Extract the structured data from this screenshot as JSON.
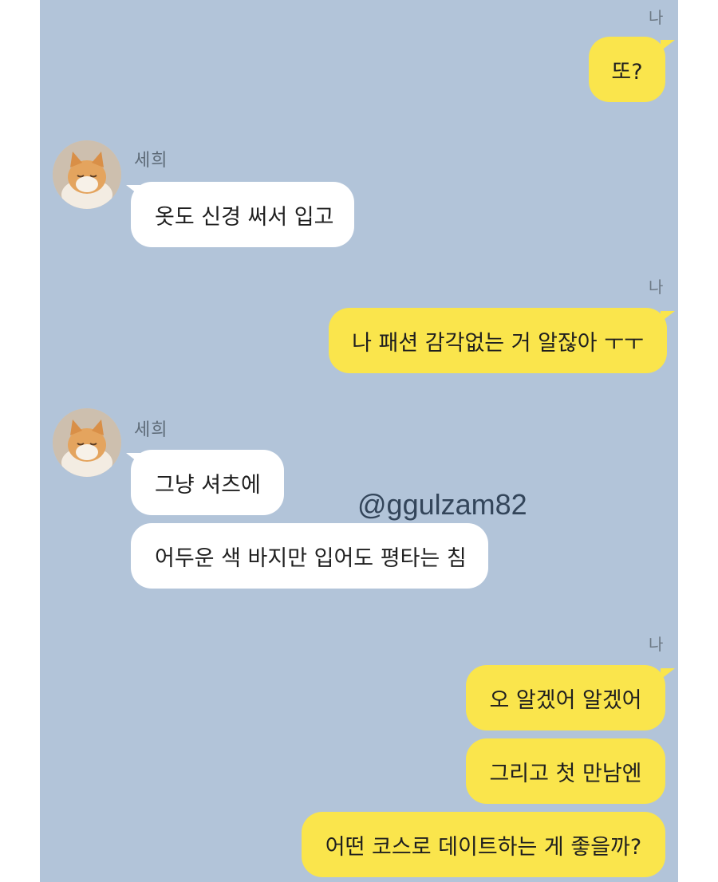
{
  "watermark": "@ggulzam82",
  "messages": {
    "me_name": "나",
    "other_name": "세희",
    "m1": "또?",
    "m2": "옷도 신경 써서 입고",
    "m3": "나 패션 감각없는 거 알잖아 ㅜㅜ",
    "m4": "그냥 셔츠에",
    "m5": "어두운 색 바지만 입어도 평타는 침",
    "m6": "오 알겠어 알겠어",
    "m7": "그리고 첫 만남엔",
    "m8": "어떤 코스로 데이트하는 게 좋을까?"
  },
  "colors": {
    "chat_background": "#b2c4d9",
    "my_bubble": "#fae54c",
    "other_bubble": "#ffffff"
  },
  "icons": {
    "avatar": "cat-photo-avatar"
  }
}
